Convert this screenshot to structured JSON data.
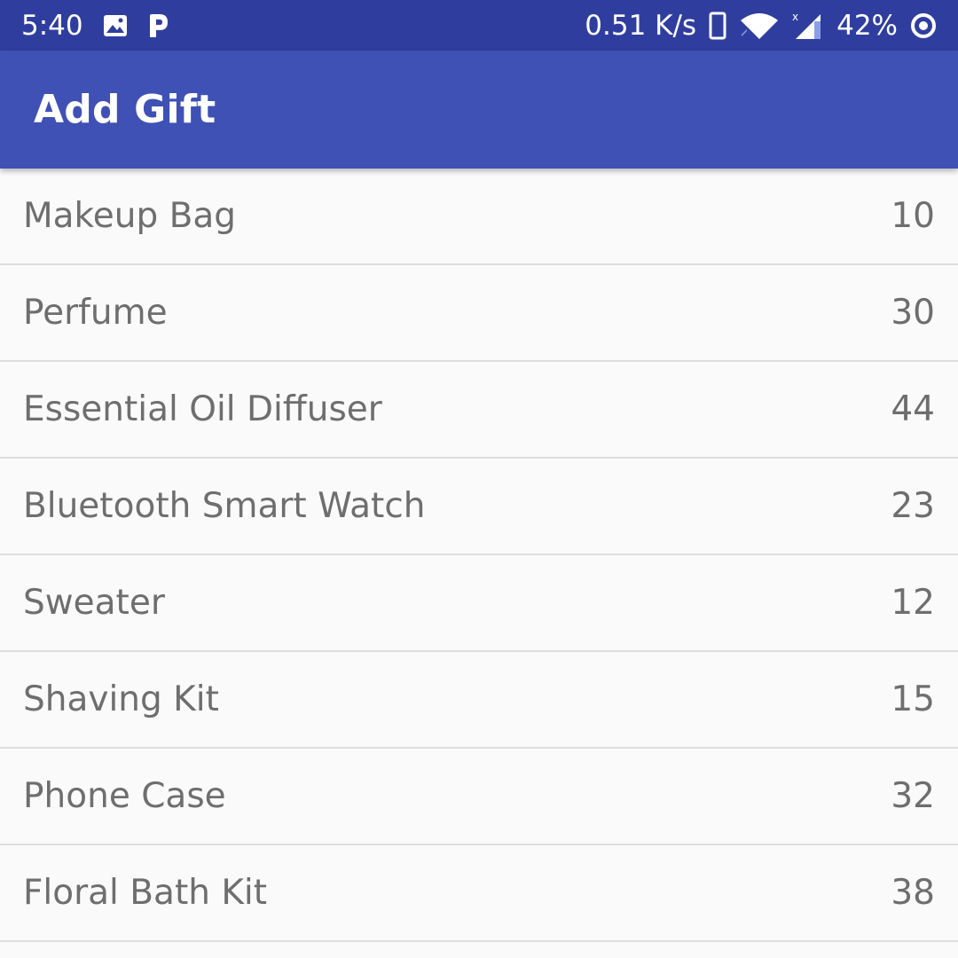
{
  "status_bar": {
    "time": "5:40",
    "net_speed": "0.51 K/s",
    "battery_percent": "42%",
    "icons": [
      "image-icon",
      "parking-icon",
      "phone-outline-icon",
      "wifi-icon",
      "signal-icon",
      "battery-ring-icon"
    ]
  },
  "app_bar": {
    "title": "Add Gift",
    "color": "#3f51b5"
  },
  "gifts": [
    {
      "name": "Makeup Bag",
      "value": "10"
    },
    {
      "name": "Perfume",
      "value": "30"
    },
    {
      "name": "Essential Oil Diffuser",
      "value": "44"
    },
    {
      "name": "Bluetooth Smart Watch",
      "value": "23"
    },
    {
      "name": "Sweater",
      "value": "12"
    },
    {
      "name": "Shaving Kit",
      "value": "15"
    },
    {
      "name": "Phone Case",
      "value": "32"
    },
    {
      "name": "Floral Bath Kit",
      "value": "38"
    }
  ]
}
